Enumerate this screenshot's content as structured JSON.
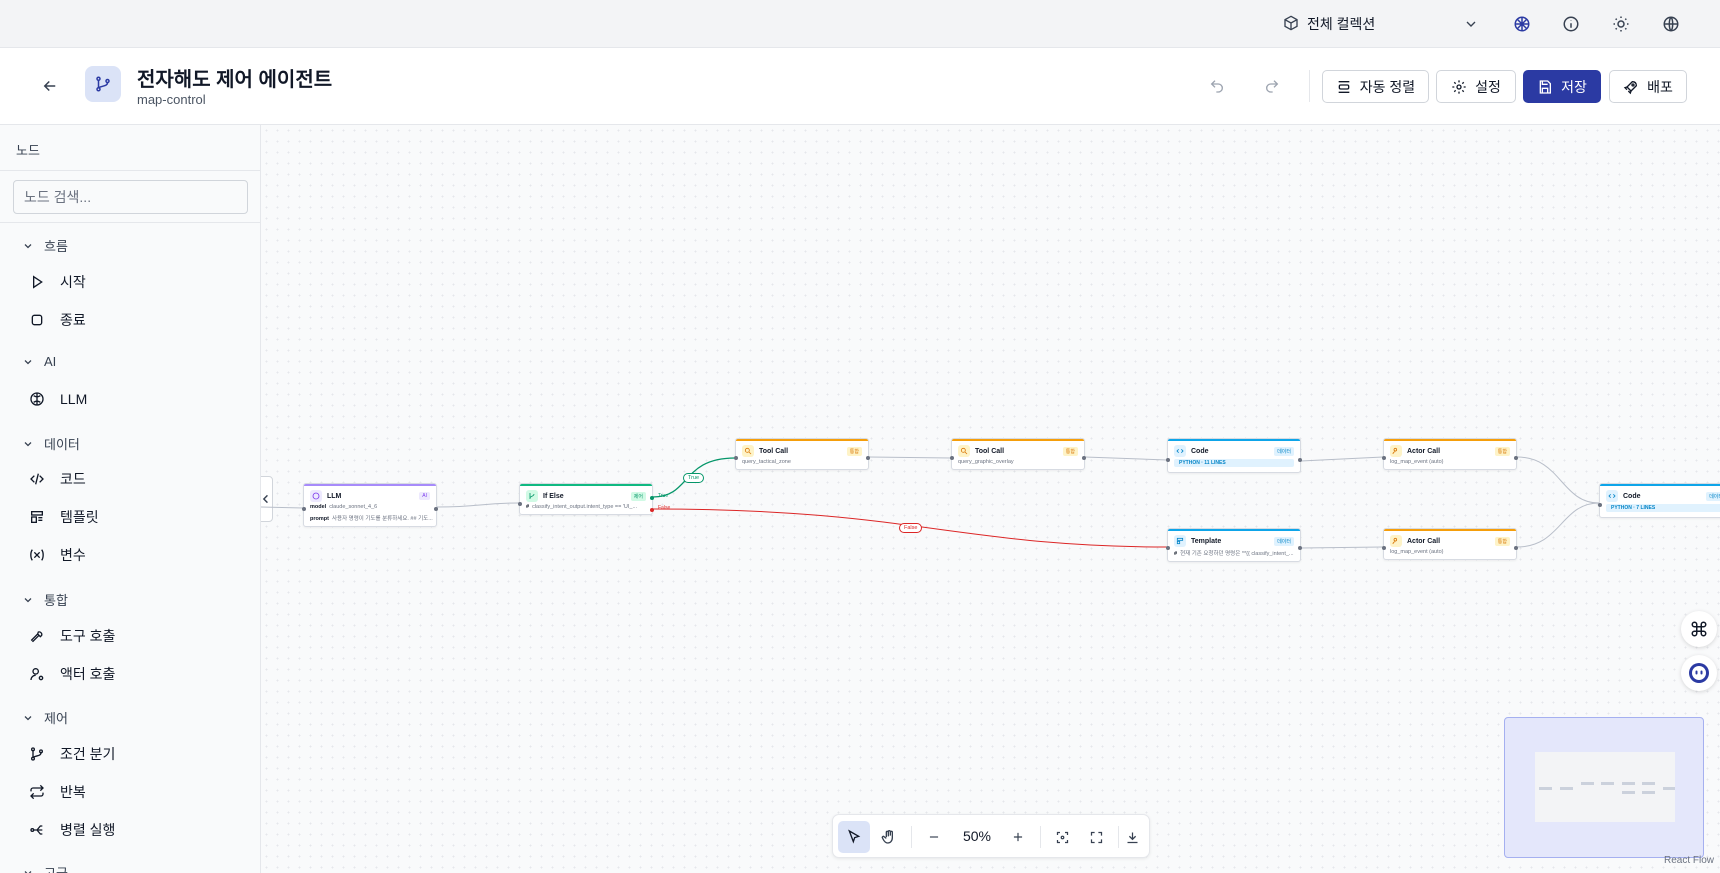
{
  "topbar": {
    "collection_label": "전체 컬렉션",
    "icons": [
      "cube-icon",
      "chevron-down-icon",
      "brain-icon",
      "info-icon",
      "sun-icon",
      "globe-icon"
    ]
  },
  "header": {
    "title": "전자해도 제어 에이전트",
    "subtitle": "map-control",
    "buttons": {
      "auto_arrange": "자동 정렬",
      "settings": "설정",
      "save": "저장",
      "deploy": "배포"
    },
    "accent_color": "#2b3aa3"
  },
  "sidebar": {
    "title": "노드",
    "search_placeholder": "노드 검색...",
    "categories": [
      {
        "label": "흐름",
        "items": [
          {
            "label": "시작",
            "icon": "play-icon"
          },
          {
            "label": "종료",
            "icon": "square-icon"
          }
        ]
      },
      {
        "label": "AI",
        "items": [
          {
            "label": "LLM",
            "icon": "brain-icon"
          }
        ]
      },
      {
        "label": "데이터",
        "items": [
          {
            "label": "코드",
            "icon": "code-icon"
          },
          {
            "label": "템플릿",
            "icon": "template-icon"
          },
          {
            "label": "변수",
            "icon": "variable-icon"
          }
        ]
      },
      {
        "label": "통합",
        "items": [
          {
            "label": "도구 호출",
            "icon": "wrench-icon"
          },
          {
            "label": "액터 호출",
            "icon": "user-gear-icon"
          }
        ]
      },
      {
        "label": "제어",
        "items": [
          {
            "label": "조건 분기",
            "icon": "git-branch-icon"
          },
          {
            "label": "반복",
            "icon": "repeat-icon"
          },
          {
            "label": "병렬 실행",
            "icon": "split-icon"
          }
        ]
      },
      {
        "label": "고급",
        "items": []
      }
    ]
  },
  "nodes": {
    "llm": {
      "title": "LLM",
      "badge": "AI",
      "model_key": "model",
      "model_val": "claude_sonnet_4_6",
      "prompt_key": "prompt",
      "prompt_val": "사용자 명령이 기도를 분류하세요. ## 기도..."
    },
    "ifelse": {
      "title": "If Else",
      "badge": "제어",
      "line": "classify_intent_output.intent_type == 'UI_...",
      "true_label": "True",
      "false_label": "False"
    },
    "tool1": {
      "title": "Tool Call",
      "badge": "통합",
      "line": "query_tactical_zone"
    },
    "tool2": {
      "title": "Tool Call",
      "badge": "통합",
      "line": "query_graphic_overlay"
    },
    "code1": {
      "title": "Code",
      "badge": "데이터",
      "pill": "PYTHON · 11 LINES"
    },
    "actor1": {
      "title": "Actor Call",
      "badge": "통합",
      "line": "log_map_event (auto)"
    },
    "template": {
      "title": "Template",
      "badge": "데이터",
      "line": "현재 기존 요청하던 명령은 **{{ classify_intent_..."
    },
    "actor2": {
      "title": "Actor Call",
      "badge": "통합",
      "line": "log_map_event (auto)"
    },
    "code2": {
      "title": "Code",
      "badge": "데이터",
      "pill": "PYTHON · 7 LINES"
    }
  },
  "edge_labels": {
    "true_label": "True",
    "false_label": "False"
  },
  "toolbar": {
    "zoom": "50%"
  },
  "branding": "React Flow",
  "colors": {
    "ai": "#a78bfa",
    "control": "#10b981",
    "integration": "#f59e0b",
    "data": "#0ea5e9",
    "false_edge": "#dc2626",
    "true_edge": "#059669"
  }
}
